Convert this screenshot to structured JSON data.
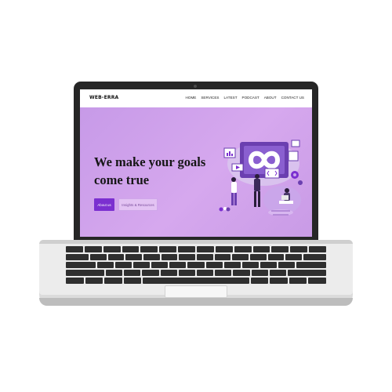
{
  "site": {
    "logo": "WEB-ERRA",
    "nav": [
      {
        "label": "HOME"
      },
      {
        "label": "SERVICES"
      },
      {
        "label": "LATEST"
      },
      {
        "label": "PODCAST"
      },
      {
        "label": "ABOUT"
      },
      {
        "label": "CONTACT US"
      }
    ]
  },
  "hero": {
    "headline": "We make your goals come true",
    "primary_button": "About us",
    "secondary_button": "Insights & Resources"
  },
  "colors": {
    "hero_bg": "#d6a8ee",
    "accent": "#7b2fd0",
    "laptop_bezel": "#262626"
  }
}
